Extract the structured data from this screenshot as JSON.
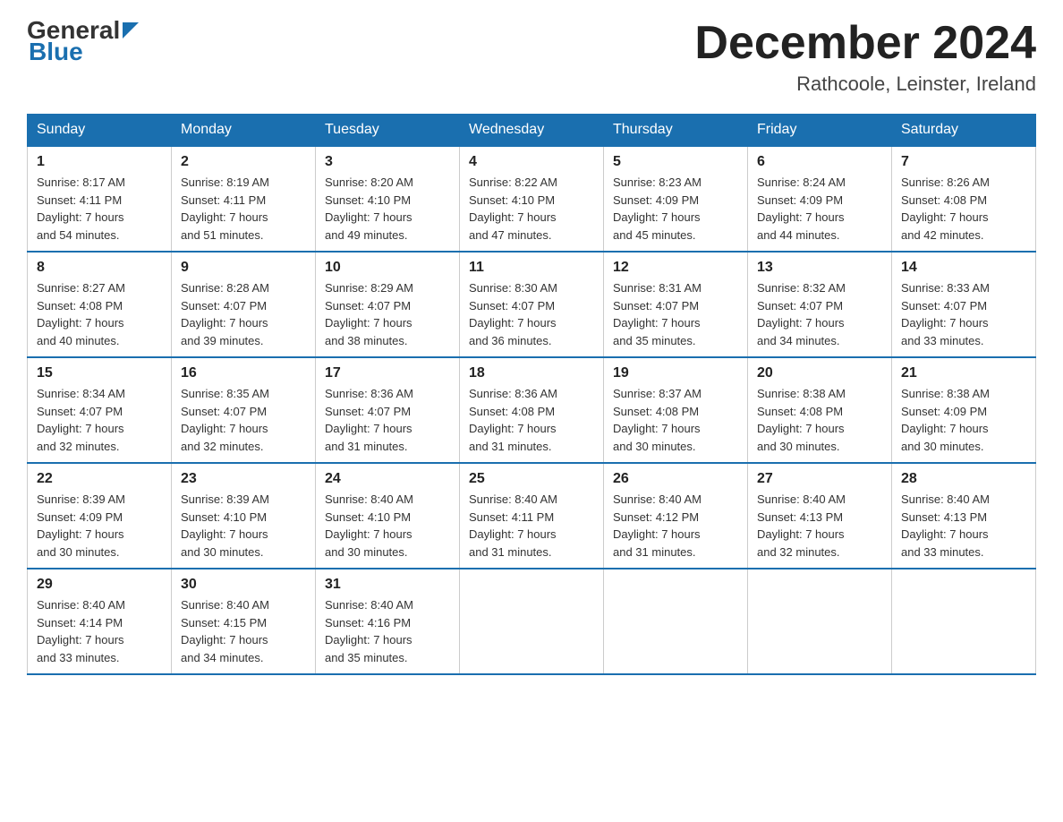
{
  "header": {
    "logo_general": "General",
    "logo_blue": "Blue",
    "month_title": "December 2024",
    "location": "Rathcoole, Leinster, Ireland"
  },
  "days_of_week": [
    "Sunday",
    "Monday",
    "Tuesday",
    "Wednesday",
    "Thursday",
    "Friday",
    "Saturday"
  ],
  "weeks": [
    [
      {
        "day": "1",
        "sunrise": "Sunrise: 8:17 AM",
        "sunset": "Sunset: 4:11 PM",
        "daylight": "Daylight: 7 hours",
        "daylight2": "and 54 minutes."
      },
      {
        "day": "2",
        "sunrise": "Sunrise: 8:19 AM",
        "sunset": "Sunset: 4:11 PM",
        "daylight": "Daylight: 7 hours",
        "daylight2": "and 51 minutes."
      },
      {
        "day": "3",
        "sunrise": "Sunrise: 8:20 AM",
        "sunset": "Sunset: 4:10 PM",
        "daylight": "Daylight: 7 hours",
        "daylight2": "and 49 minutes."
      },
      {
        "day": "4",
        "sunrise": "Sunrise: 8:22 AM",
        "sunset": "Sunset: 4:10 PM",
        "daylight": "Daylight: 7 hours",
        "daylight2": "and 47 minutes."
      },
      {
        "day": "5",
        "sunrise": "Sunrise: 8:23 AM",
        "sunset": "Sunset: 4:09 PM",
        "daylight": "Daylight: 7 hours",
        "daylight2": "and 45 minutes."
      },
      {
        "day": "6",
        "sunrise": "Sunrise: 8:24 AM",
        "sunset": "Sunset: 4:09 PM",
        "daylight": "Daylight: 7 hours",
        "daylight2": "and 44 minutes."
      },
      {
        "day": "7",
        "sunrise": "Sunrise: 8:26 AM",
        "sunset": "Sunset: 4:08 PM",
        "daylight": "Daylight: 7 hours",
        "daylight2": "and 42 minutes."
      }
    ],
    [
      {
        "day": "8",
        "sunrise": "Sunrise: 8:27 AM",
        "sunset": "Sunset: 4:08 PM",
        "daylight": "Daylight: 7 hours",
        "daylight2": "and 40 minutes."
      },
      {
        "day": "9",
        "sunrise": "Sunrise: 8:28 AM",
        "sunset": "Sunset: 4:07 PM",
        "daylight": "Daylight: 7 hours",
        "daylight2": "and 39 minutes."
      },
      {
        "day": "10",
        "sunrise": "Sunrise: 8:29 AM",
        "sunset": "Sunset: 4:07 PM",
        "daylight": "Daylight: 7 hours",
        "daylight2": "and 38 minutes."
      },
      {
        "day": "11",
        "sunrise": "Sunrise: 8:30 AM",
        "sunset": "Sunset: 4:07 PM",
        "daylight": "Daylight: 7 hours",
        "daylight2": "and 36 minutes."
      },
      {
        "day": "12",
        "sunrise": "Sunrise: 8:31 AM",
        "sunset": "Sunset: 4:07 PM",
        "daylight": "Daylight: 7 hours",
        "daylight2": "and 35 minutes."
      },
      {
        "day": "13",
        "sunrise": "Sunrise: 8:32 AM",
        "sunset": "Sunset: 4:07 PM",
        "daylight": "Daylight: 7 hours",
        "daylight2": "and 34 minutes."
      },
      {
        "day": "14",
        "sunrise": "Sunrise: 8:33 AM",
        "sunset": "Sunset: 4:07 PM",
        "daylight": "Daylight: 7 hours",
        "daylight2": "and 33 minutes."
      }
    ],
    [
      {
        "day": "15",
        "sunrise": "Sunrise: 8:34 AM",
        "sunset": "Sunset: 4:07 PM",
        "daylight": "Daylight: 7 hours",
        "daylight2": "and 32 minutes."
      },
      {
        "day": "16",
        "sunrise": "Sunrise: 8:35 AM",
        "sunset": "Sunset: 4:07 PM",
        "daylight": "Daylight: 7 hours",
        "daylight2": "and 32 minutes."
      },
      {
        "day": "17",
        "sunrise": "Sunrise: 8:36 AM",
        "sunset": "Sunset: 4:07 PM",
        "daylight": "Daylight: 7 hours",
        "daylight2": "and 31 minutes."
      },
      {
        "day": "18",
        "sunrise": "Sunrise: 8:36 AM",
        "sunset": "Sunset: 4:08 PM",
        "daylight": "Daylight: 7 hours",
        "daylight2": "and 31 minutes."
      },
      {
        "day": "19",
        "sunrise": "Sunrise: 8:37 AM",
        "sunset": "Sunset: 4:08 PM",
        "daylight": "Daylight: 7 hours",
        "daylight2": "and 30 minutes."
      },
      {
        "day": "20",
        "sunrise": "Sunrise: 8:38 AM",
        "sunset": "Sunset: 4:08 PM",
        "daylight": "Daylight: 7 hours",
        "daylight2": "and 30 minutes."
      },
      {
        "day": "21",
        "sunrise": "Sunrise: 8:38 AM",
        "sunset": "Sunset: 4:09 PM",
        "daylight": "Daylight: 7 hours",
        "daylight2": "and 30 minutes."
      }
    ],
    [
      {
        "day": "22",
        "sunrise": "Sunrise: 8:39 AM",
        "sunset": "Sunset: 4:09 PM",
        "daylight": "Daylight: 7 hours",
        "daylight2": "and 30 minutes."
      },
      {
        "day": "23",
        "sunrise": "Sunrise: 8:39 AM",
        "sunset": "Sunset: 4:10 PM",
        "daylight": "Daylight: 7 hours",
        "daylight2": "and 30 minutes."
      },
      {
        "day": "24",
        "sunrise": "Sunrise: 8:40 AM",
        "sunset": "Sunset: 4:10 PM",
        "daylight": "Daylight: 7 hours",
        "daylight2": "and 30 minutes."
      },
      {
        "day": "25",
        "sunrise": "Sunrise: 8:40 AM",
        "sunset": "Sunset: 4:11 PM",
        "daylight": "Daylight: 7 hours",
        "daylight2": "and 31 minutes."
      },
      {
        "day": "26",
        "sunrise": "Sunrise: 8:40 AM",
        "sunset": "Sunset: 4:12 PM",
        "daylight": "Daylight: 7 hours",
        "daylight2": "and 31 minutes."
      },
      {
        "day": "27",
        "sunrise": "Sunrise: 8:40 AM",
        "sunset": "Sunset: 4:13 PM",
        "daylight": "Daylight: 7 hours",
        "daylight2": "and 32 minutes."
      },
      {
        "day": "28",
        "sunrise": "Sunrise: 8:40 AM",
        "sunset": "Sunset: 4:13 PM",
        "daylight": "Daylight: 7 hours",
        "daylight2": "and 33 minutes."
      }
    ],
    [
      {
        "day": "29",
        "sunrise": "Sunrise: 8:40 AM",
        "sunset": "Sunset: 4:14 PM",
        "daylight": "Daylight: 7 hours",
        "daylight2": "and 33 minutes."
      },
      {
        "day": "30",
        "sunrise": "Sunrise: 8:40 AM",
        "sunset": "Sunset: 4:15 PM",
        "daylight": "Daylight: 7 hours",
        "daylight2": "and 34 minutes."
      },
      {
        "day": "31",
        "sunrise": "Sunrise: 8:40 AM",
        "sunset": "Sunset: 4:16 PM",
        "daylight": "Daylight: 7 hours",
        "daylight2": "and 35 minutes."
      },
      null,
      null,
      null,
      null
    ]
  ]
}
